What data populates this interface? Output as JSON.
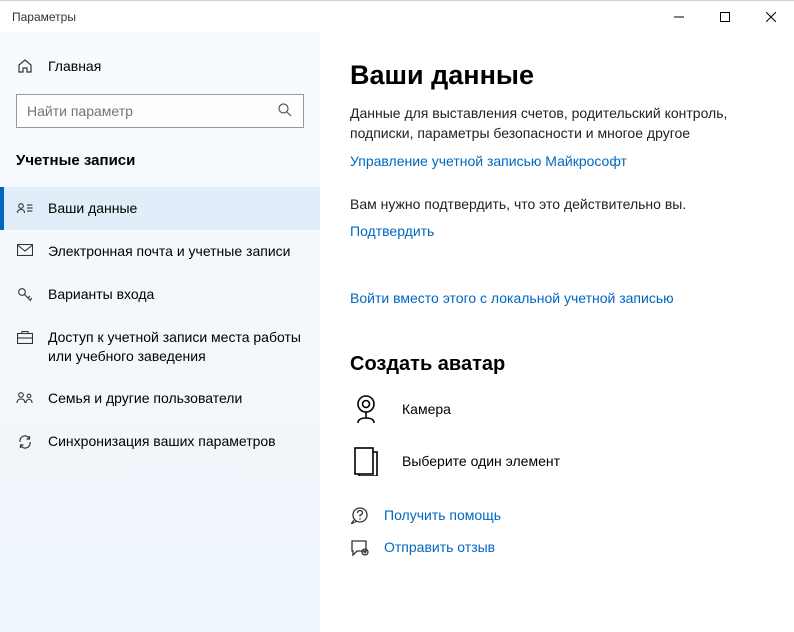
{
  "window": {
    "title": "Параметры"
  },
  "sidebar": {
    "home": "Главная",
    "search_placeholder": "Найти параметр",
    "section": "Учетные записи",
    "items": [
      {
        "label": "Ваши данные"
      },
      {
        "label": "Электронная почта и учетные записи"
      },
      {
        "label": "Варианты входа"
      },
      {
        "label": "Доступ к учетной записи места работы или учебного заведения"
      },
      {
        "label": "Семья и другие пользователи"
      },
      {
        "label": "Синхронизация ваших параметров"
      }
    ]
  },
  "main": {
    "title": "Ваши данные",
    "description": "Данные для выставления счетов, родительский контроль, подписки, параметры безопасности и многое другое",
    "manage_link": "Управление учетной записью Майкрософт",
    "verify_text": "Вам нужно подтвердить, что это действительно вы.",
    "verify_link": "Подтвердить",
    "local_signin_link": "Войти вместо этого с локальной учетной записью",
    "avatar_heading": "Создать аватар",
    "avatar_camera": "Камера",
    "avatar_browse": "Выберите один элемент",
    "help_link": "Получить помощь",
    "feedback_link": "Отправить отзыв"
  }
}
